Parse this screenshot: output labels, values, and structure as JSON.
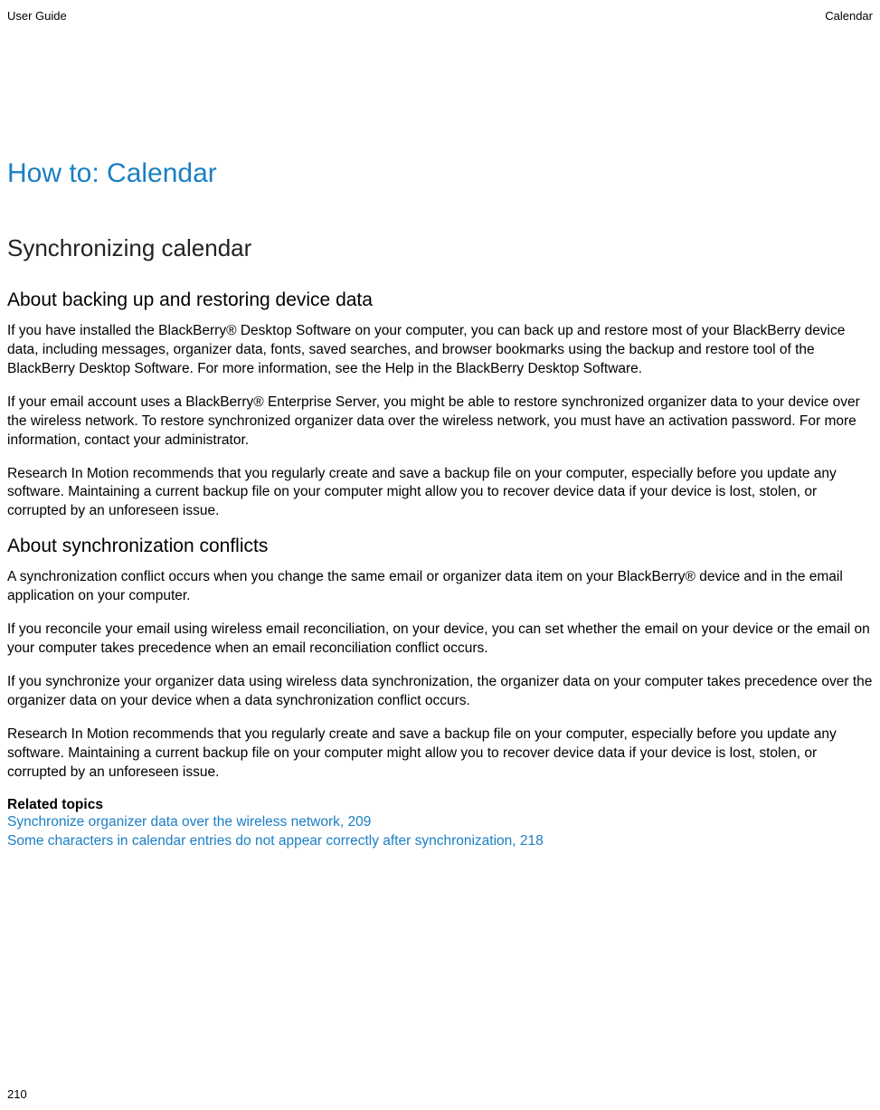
{
  "header": {
    "left": "User Guide",
    "right": "Calendar"
  },
  "h1": "How to: Calendar",
  "h2": "Synchronizing calendar",
  "section1": {
    "title": "About backing up and restoring device data",
    "p1": "If you have installed the BlackBerry® Desktop Software on your computer, you can back up and restore most of your BlackBerry device data, including messages, organizer data, fonts, saved searches, and browser bookmarks using the backup and restore tool of the BlackBerry Desktop Software. For more information, see the Help in the BlackBerry Desktop Software.",
    "p2": "If your email account uses a BlackBerry® Enterprise Server, you might be able to restore synchronized organizer data to your device over the wireless network. To restore synchronized organizer data over the wireless network, you must have an activation password. For more information, contact your administrator.",
    "p3": "Research In Motion recommends that you regularly create and save a backup file on your computer, especially before you update any software. Maintaining a current backup file on your computer might allow you to recover device data if your device is lost, stolen, or corrupted by an unforeseen issue."
  },
  "section2": {
    "title": "About synchronization conflicts",
    "p1": "A synchronization conflict occurs when you change the same email or organizer data item on your BlackBerry® device and in the email application on your computer.",
    "p2": "If you reconcile your email using wireless email reconciliation, on your device, you can set whether the email on your device or the email on your computer takes precedence when an email reconciliation conflict occurs.",
    "p3": "If you synchronize your organizer data using wireless data synchronization, the organizer data on your computer takes precedence over the organizer data on your device when a data synchronization conflict occurs.",
    "p4": "Research In Motion recommends that you regularly create and save a backup file on your computer, especially before you update any software. Maintaining a current backup file on your computer might allow you to recover device data if your device is lost, stolen, or corrupted by an unforeseen issue."
  },
  "related": {
    "label": "Related topics",
    "link1": "Synchronize organizer data over the wireless network, 209",
    "link2": "Some characters in calendar entries do not appear correctly after synchronization, 218"
  },
  "pageNumber": "210"
}
